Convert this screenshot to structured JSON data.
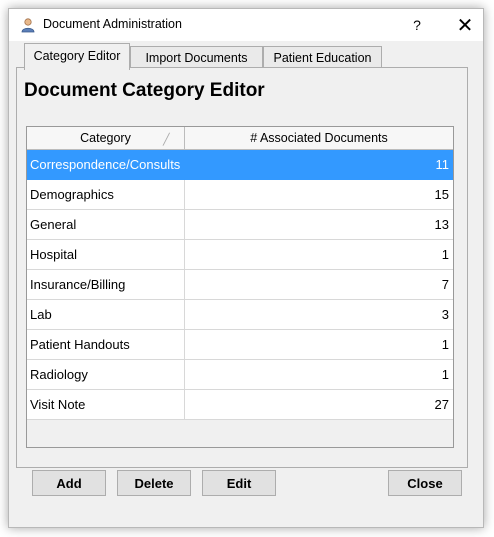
{
  "window": {
    "title": "Document Administration",
    "help_label": "?",
    "close_label": "✕"
  },
  "tabs": [
    {
      "label": "Category Editor",
      "active": true
    },
    {
      "label": "Import Documents",
      "active": false
    },
    {
      "label": "Patient Education",
      "active": false
    }
  ],
  "heading": "Document Category Editor",
  "table": {
    "columns": [
      "Category",
      "# Associated Documents"
    ],
    "rows": [
      {
        "category": "Correspondence/Consults",
        "count": "11",
        "selected": true
      },
      {
        "category": "Demographics",
        "count": "15"
      },
      {
        "category": "General",
        "count": "13"
      },
      {
        "category": "Hospital",
        "count": "1"
      },
      {
        "category": "Insurance/Billing",
        "count": "7"
      },
      {
        "category": "Lab",
        "count": "3"
      },
      {
        "category": "Patient Handouts",
        "count": "1"
      },
      {
        "category": "Radiology",
        "count": "1"
      },
      {
        "category": "Visit Note",
        "count": "27"
      }
    ]
  },
  "buttons": {
    "add": "Add",
    "delete": "Delete",
    "edit": "Edit",
    "close": "Close"
  },
  "colors": {
    "selection": "#3399ff",
    "window_bg": "#f0f0f0"
  }
}
